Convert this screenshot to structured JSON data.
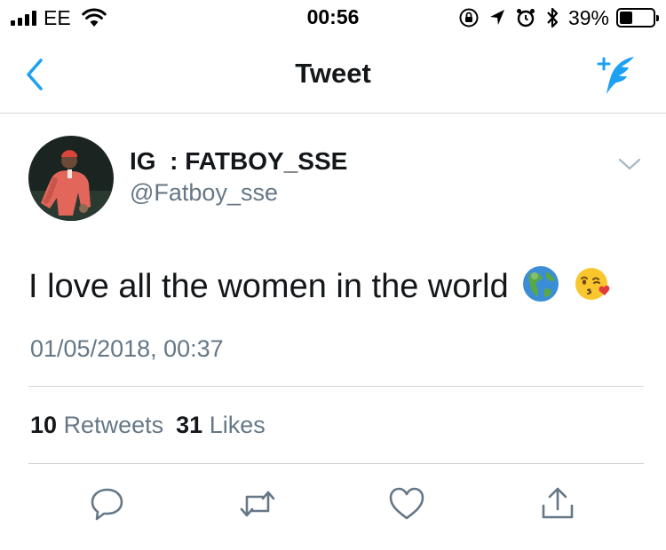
{
  "status_bar": {
    "carrier": "EE",
    "time": "00:56",
    "battery_percent": "39%",
    "battery_level": 0.39,
    "icons": [
      "signal-bars-icon",
      "wifi-icon",
      "rotation-lock-icon",
      "location-arrow-icon",
      "alarm-icon",
      "bluetooth-icon",
      "battery-icon"
    ]
  },
  "nav": {
    "title": "Tweet",
    "back_icon": "chevron-left-icon",
    "compose_icon": "compose-tweet-icon"
  },
  "tweet": {
    "display_name": "IG  : FATBOY_SSE",
    "handle": "@Fatboy_sse",
    "text": "I love all the women in the world",
    "emojis": [
      "globe-americas-emoji",
      "face-blowing-kiss-emoji"
    ],
    "timestamp": "01/05/2018, 00:37",
    "retweets_count": "10",
    "retweets_label": "Retweets",
    "likes_count": "31",
    "likes_label": "Likes"
  },
  "actions": [
    "reply-icon",
    "retweet-icon",
    "like-icon",
    "share-icon"
  ],
  "colors": {
    "accent": "#1da1f2",
    "text_primary": "#14171a",
    "text_secondary": "#657786",
    "divider": "#d2d6da"
  }
}
